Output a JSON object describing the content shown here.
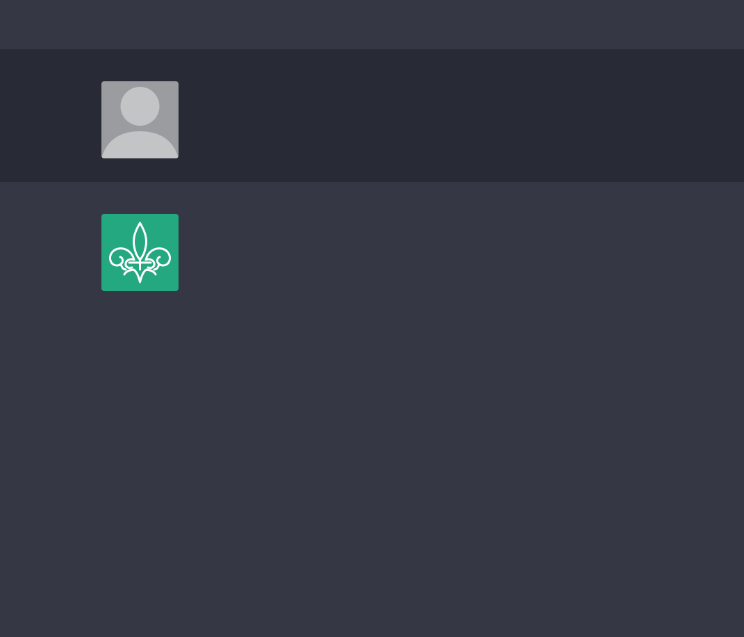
{
  "conversation": {
    "messages": [
      {
        "role": "user",
        "avatar_icon": "default-user-avatar-icon",
        "avatar_bg": "#9a9ca0",
        "avatar_fg": "#c3c4c6",
        "row_bg": "#282a36"
      },
      {
        "role": "assistant",
        "avatar_icon": "fleur-de-lis-icon",
        "avatar_bg": "#24a87f",
        "avatar_fg": "#ffffff",
        "row_bg": "#363744"
      }
    ]
  },
  "theme": {
    "page_bg": "#363744"
  }
}
